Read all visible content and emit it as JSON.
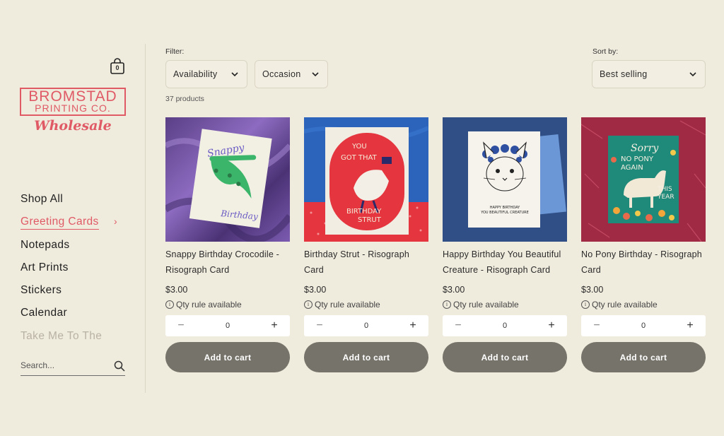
{
  "cart": {
    "count": "0"
  },
  "logo": {
    "line1": "BROMSTAD",
    "line2": "PRINTING CO.",
    "script": "Wholesale"
  },
  "nav": {
    "items": [
      {
        "label": "Shop All"
      },
      {
        "label": "Greeting Cards"
      },
      {
        "label": "Notepads"
      },
      {
        "label": "Art Prints"
      },
      {
        "label": "Stickers"
      },
      {
        "label": "Calendar"
      },
      {
        "label": "Take Me To The"
      }
    ]
  },
  "search": {
    "placeholder": "Search..."
  },
  "filter": {
    "label": "Filter:",
    "availability": "Availability",
    "occasion": "Occasion"
  },
  "sort": {
    "label": "Sort by:",
    "value": "Best selling"
  },
  "product_count": "37 products",
  "qty_rule": "Qty rule available",
  "add_to_cart": "Add to cart",
  "products": [
    {
      "title": "Snappy Birthday Crocodile - Risograph Card",
      "price": "$3.00",
      "qty": "0",
      "img_text": [
        "Snappy",
        "Birthday"
      ]
    },
    {
      "title": "Birthday Strut - Risograph Card",
      "price": "$3.00",
      "qty": "0",
      "img_text": [
        "YOU",
        "GOT THAT",
        "BIRTHDAY",
        "STRUT"
      ]
    },
    {
      "title": "Happy Birthday You Beautiful Creature - Risograph Card",
      "price": "$3.00",
      "qty": "0",
      "img_text": [
        "HAPPY BIRTHDAY",
        "YOU BEAUTIFUL CREATURE"
      ]
    },
    {
      "title": "No Pony Birthday - Risograph Card",
      "price": "$3.00",
      "qty": "0",
      "img_text": [
        "Sorry",
        "NO PONY",
        "AGAIN",
        "THIS",
        "YEAR"
      ]
    }
  ],
  "colors": {
    "background": "#efebdd",
    "accent": "#e05a66",
    "button": "#76736a"
  }
}
